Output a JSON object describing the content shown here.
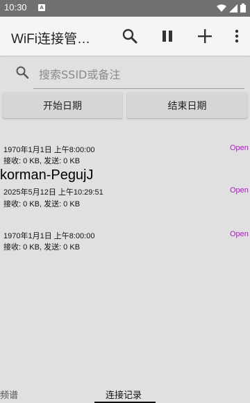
{
  "status_bar": {
    "time": "10:30",
    "notif_letter": "A"
  },
  "app_bar": {
    "title": "WiFi连接管…",
    "icons": [
      "search-icon",
      "pause-icon",
      "add-icon",
      "more-vert-icon"
    ]
  },
  "search": {
    "placeholder": "搜索SSID或备注",
    "value": ""
  },
  "filters": {
    "start_date": "开始日期",
    "end_date": "结束日期"
  },
  "records": [
    {
      "name": "",
      "time": "1970年1月1日 上午8:00:00",
      "stats": "接收: 0 KB, 发送: 0 KB",
      "status": "Open"
    },
    {
      "name": "korman-PegujJ",
      "time": "2025年5月12日 上午10:29:51",
      "stats": "接收: 0 KB, 发送: 0 KB",
      "status": "Open"
    },
    {
      "name": "",
      "time": "1970年1月1日 上午8:00:00",
      "stats": "接收: 0 KB, 发送: 0 KB",
      "status": "Open"
    }
  ],
  "bottom_nav": {
    "tabs": [
      "频谱",
      "连接记录"
    ],
    "selected": "连接记录"
  },
  "colors": {
    "status_bar": "#707070",
    "app_bar": "#f5f5f5",
    "background": "#e0e0e0",
    "open_status": "#9c27b0"
  }
}
